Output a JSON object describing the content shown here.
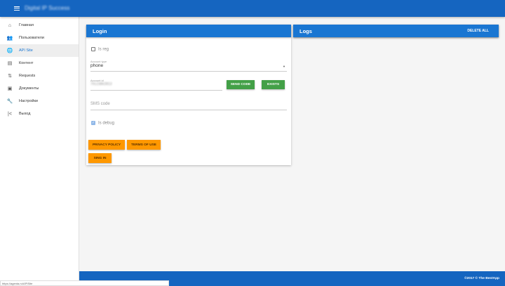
{
  "header": {
    "title": "Digital IP Success"
  },
  "sidebar": {
    "items": [
      {
        "label": "Главная",
        "icon": "home-icon",
        "glyph": "⌂"
      },
      {
        "label": "Пользователи",
        "icon": "users-icon",
        "glyph": "👥"
      },
      {
        "label": "API Site",
        "icon": "globe-icon",
        "glyph": "🌐"
      },
      {
        "label": "Контент",
        "icon": "content-icon",
        "glyph": "▤"
      },
      {
        "label": "Requests",
        "icon": "requests-icon",
        "glyph": "⇅"
      },
      {
        "label": "Документы",
        "icon": "documents-icon",
        "glyph": "▣"
      },
      {
        "label": "Настройки",
        "icon": "wrench-icon",
        "glyph": "🔧"
      },
      {
        "label": "Выход",
        "icon": "exit-icon",
        "glyph": "|<"
      }
    ]
  },
  "login": {
    "title": "Login",
    "is_reg": "Is reg",
    "account_type_label": "Account type",
    "account_type_value": "phone",
    "account_id_label": "Account id",
    "account_id_value": "79123862813",
    "send_code": "SEND CODE",
    "exists": "EXISTS",
    "sms_placeholder": "SMS code",
    "is_debug": "Is debug",
    "privacy": "PRIVACY POLICY",
    "terms": "TERMS OF USE",
    "sign_in": "SING IN"
  },
  "logs": {
    "title": "Logs",
    "delete_all": "DELETE ALL"
  },
  "footer": {
    "text": "©2017 © The BestApp"
  },
  "status_bar": {
    "url": "https://agenta.ru/APISite"
  }
}
